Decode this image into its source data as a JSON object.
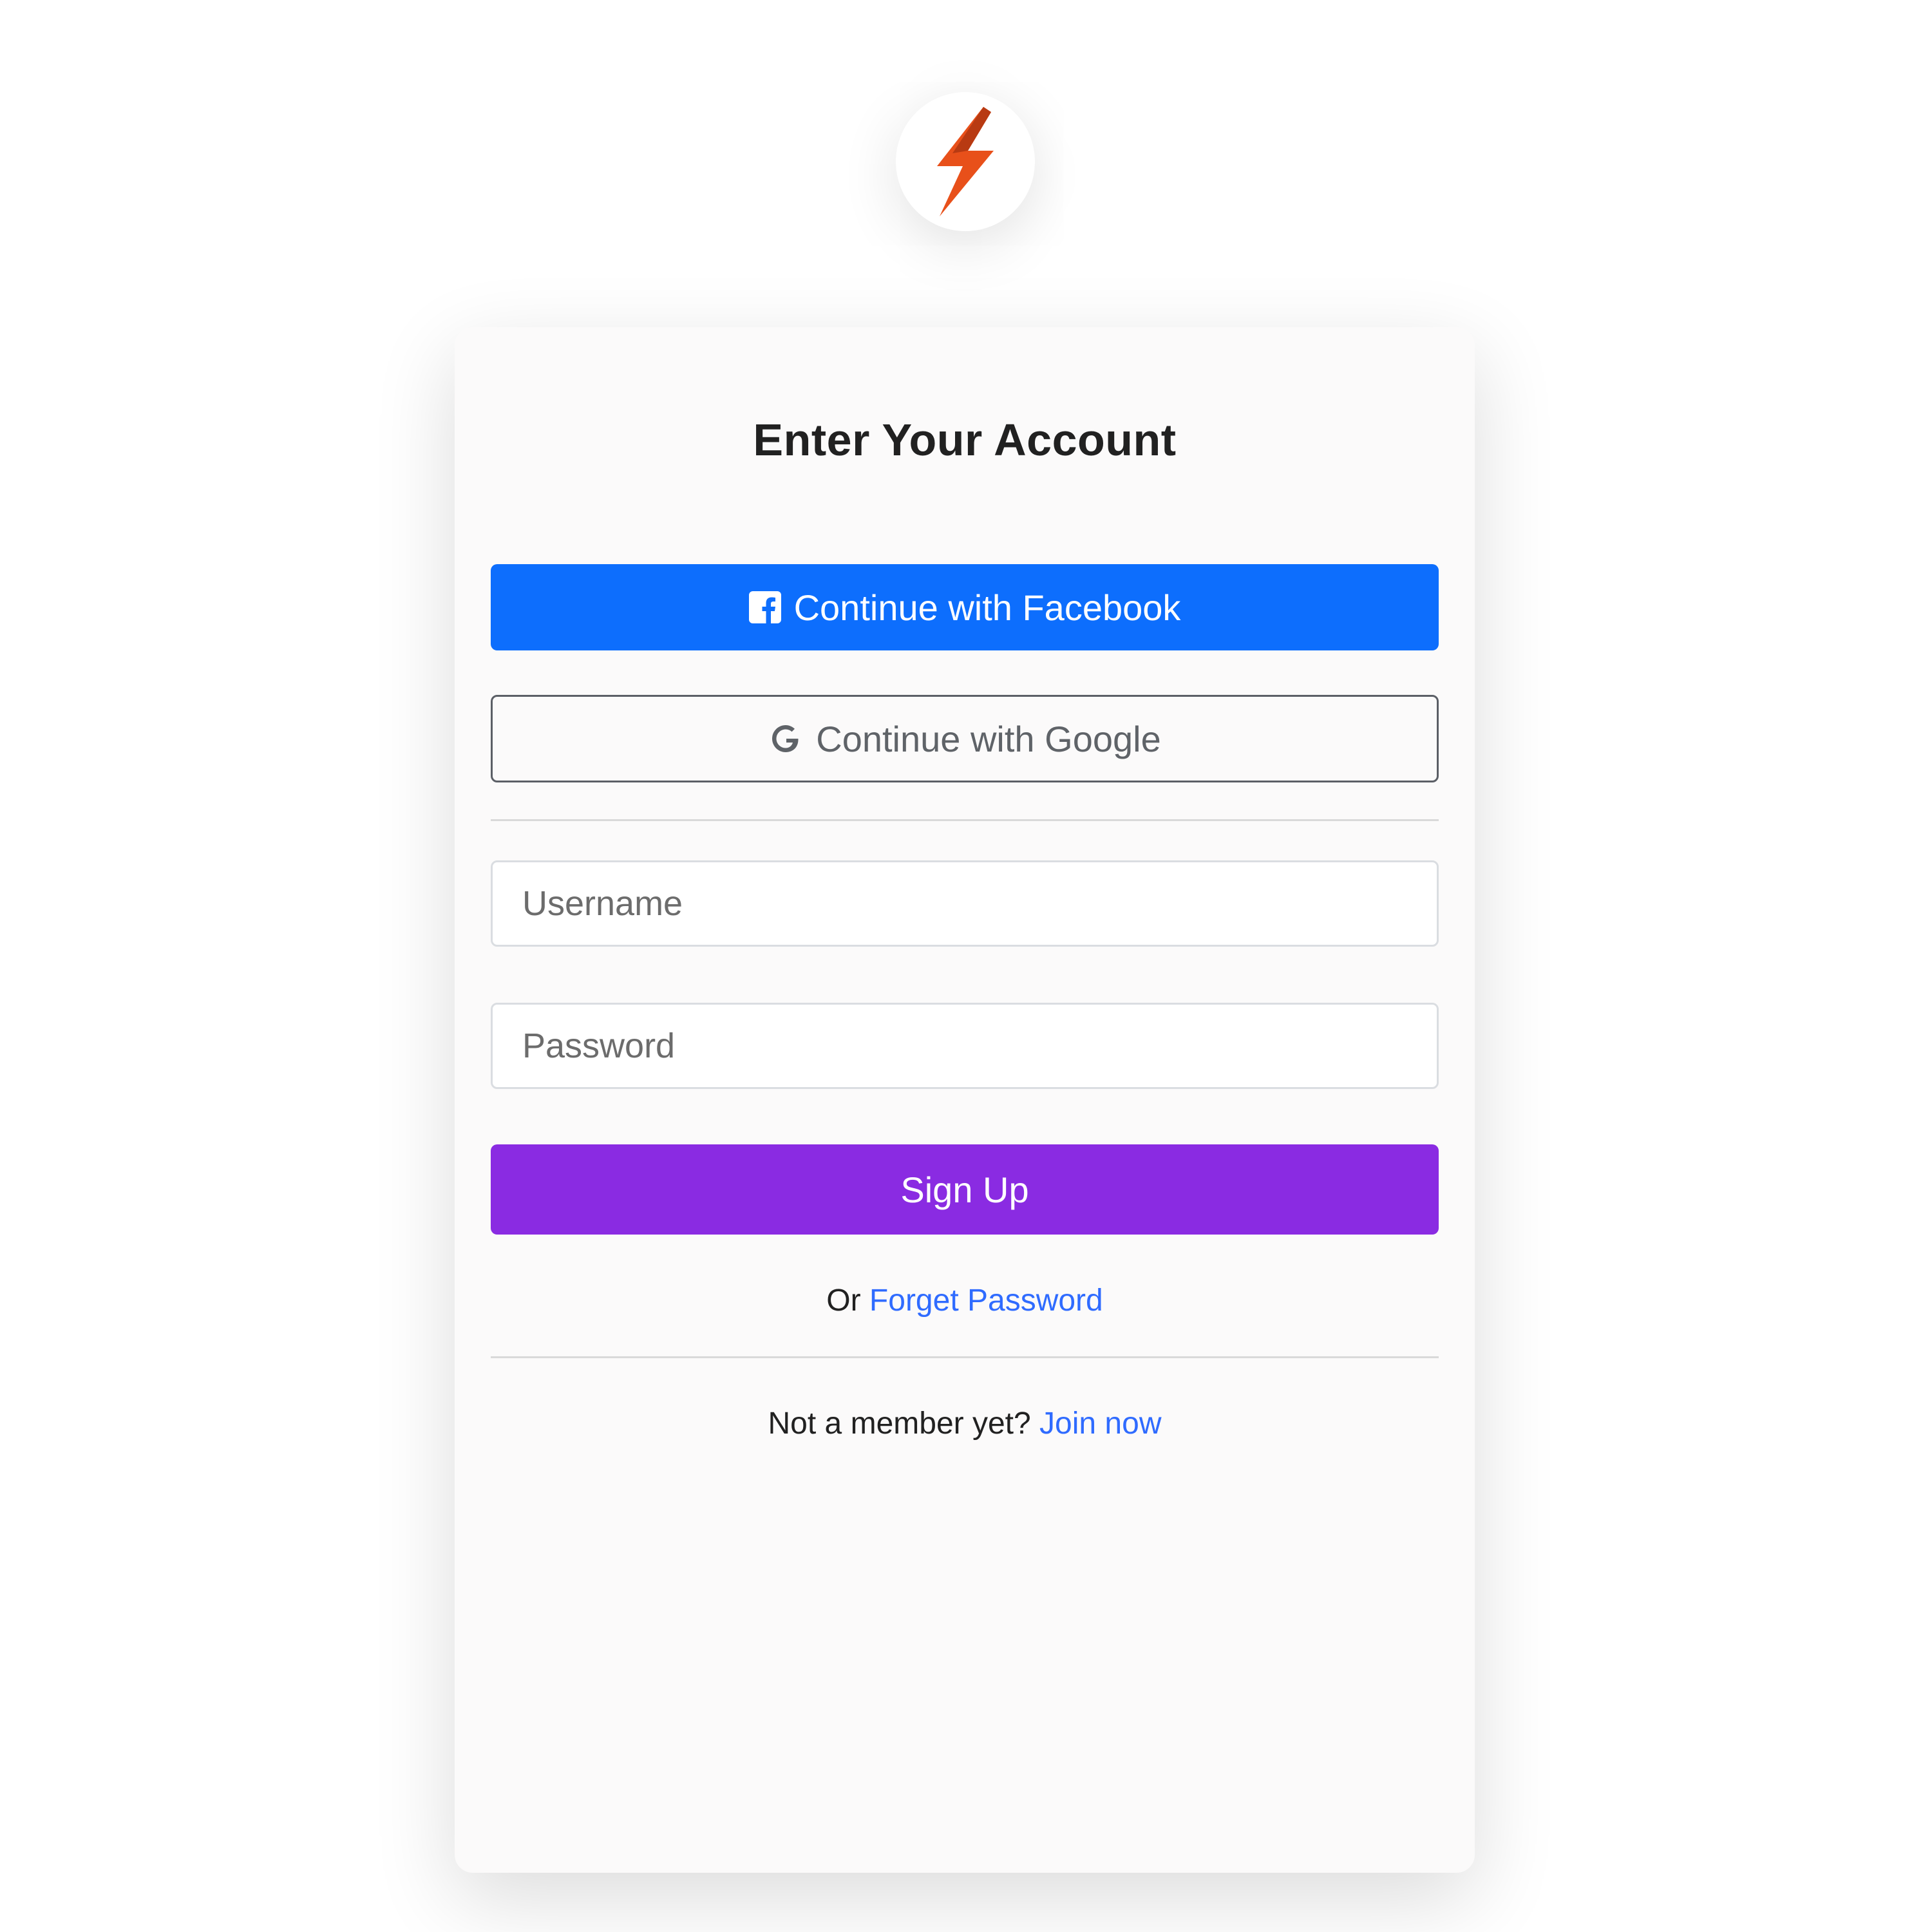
{
  "logo": {
    "icon": "lightning-bolt-icon",
    "color": "#e8501a"
  },
  "card": {
    "title": "Enter Your Account",
    "facebook_button": {
      "label": "Continue with Facebook",
      "icon": "facebook-icon",
      "color": "#0d6efd"
    },
    "google_button": {
      "label": "Continue with Google",
      "icon": "google-icon"
    },
    "username": {
      "placeholder": "Username",
      "value": ""
    },
    "password": {
      "placeholder": "Password",
      "value": ""
    },
    "signup_button": {
      "label": "Sign Up",
      "color": "#8a2be2"
    },
    "forget_line": {
      "prefix": "Or",
      "link": "Forget Password"
    },
    "member_line": {
      "prefix": "Not a member yet?",
      "link": "Join now"
    }
  }
}
